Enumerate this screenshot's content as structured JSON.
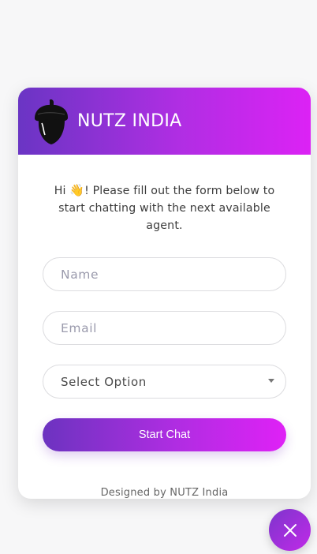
{
  "header": {
    "brand_name": "NUTZ INDIA",
    "logo_icon": "acorn-icon"
  },
  "intro": {
    "greeting": "Hi ",
    "wave_emoji": "👋",
    "message": "! Please fill out the form below to start chatting with the next available agent."
  },
  "form": {
    "name_placeholder": "Name",
    "email_placeholder": "Email",
    "select_value": "Select Option",
    "submit_label": "Start Chat"
  },
  "footer": {
    "text": "Designed by NUTZ India"
  },
  "fab": {
    "icon": "close-icon"
  },
  "colors": {
    "gradient_start": "#6a35c4",
    "gradient_end": "#dc22f5",
    "background": "#f7f7f8"
  }
}
